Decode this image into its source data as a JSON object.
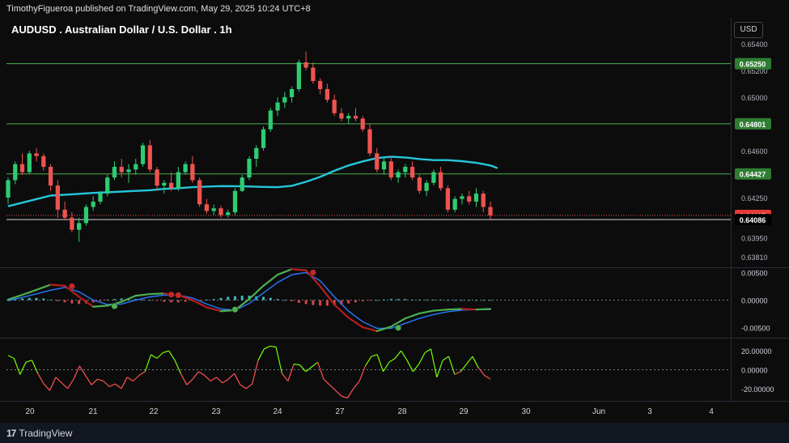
{
  "header": {
    "published_by": "TimothyFigueroa published on TradingView.com, May 29, 2025 10:24 UTC+8"
  },
  "title": "AUDUSD . Australian Dollar / U.S. Dollar . 1h",
  "currency": "USD",
  "footer": {
    "brand": "TradingView"
  },
  "colors": {
    "background": "#0c0c0c",
    "up": "#26a69a",
    "up_bright": "#2ecc71",
    "down": "#ef5350",
    "ma": "#26c6da",
    "level_line": "#4caf50",
    "tag_green": "#2e7d32",
    "tag_red": "#e53935",
    "tag_black": "#000000"
  },
  "chart_data": [
    {
      "type": "candlestick",
      "name": "price",
      "x_tick_labels": [
        "20",
        "21",
        "22",
        "23",
        "24",
        "27",
        "28",
        "29",
        "30",
        "Jun",
        "3",
        "4"
      ],
      "y_tick_labels": [
        "0.65400",
        "0.65200",
        "0.65000",
        "0.64600",
        "0.64250",
        "0.63950",
        "0.63810"
      ],
      "ylim": [
        0.6373,
        0.6558
      ],
      "levels": [
        {
          "value": 0.6525,
          "label": "0.65250",
          "style": "green-line"
        },
        {
          "value": 0.64801,
          "label": "0.64801",
          "style": "green-line"
        },
        {
          "value": 0.64427,
          "label": "0.64427",
          "style": "green-line"
        },
        {
          "value": 0.64117,
          "label": "0.64117",
          "style": "red-dotted-current-price"
        },
        {
          "value": 0.64086,
          "label": "0.64086",
          "style": "black-line"
        }
      ],
      "moving_average_path": [
        [
          0,
          0.64185
        ],
        [
          3,
          0.64225
        ],
        [
          6,
          0.64265
        ],
        [
          9,
          0.64275
        ],
        [
          12,
          0.64285
        ],
        [
          15,
          0.64292
        ],
        [
          18,
          0.643
        ],
        [
          20,
          0.64305
        ],
        [
          22,
          0.64315
        ],
        [
          24,
          0.6432
        ],
        [
          26,
          0.64328
        ],
        [
          28,
          0.64332
        ],
        [
          30,
          0.64336
        ],
        [
          33,
          0.64335
        ],
        [
          36,
          0.6433
        ],
        [
          38,
          0.64328
        ],
        [
          40,
          0.64338
        ],
        [
          42,
          0.64368
        ],
        [
          44,
          0.64405
        ],
        [
          46,
          0.6445
        ],
        [
          48,
          0.6449
        ],
        [
          50,
          0.6452
        ],
        [
          52,
          0.64545
        ],
        [
          54,
          0.64555
        ],
        [
          56,
          0.6455
        ],
        [
          58,
          0.64538
        ],
        [
          60,
          0.6453
        ],
        [
          62,
          0.6453
        ],
        [
          64,
          0.64522
        ],
        [
          66,
          0.6451
        ],
        [
          68,
          0.6449
        ],
        [
          69,
          0.6447
        ]
      ],
      "candles": [
        [
          0.6425,
          0.644,
          0.642,
          0.6438
        ],
        [
          0.6438,
          0.6452,
          0.6435,
          0.645
        ],
        [
          0.645,
          0.6458,
          0.6442,
          0.6444
        ],
        [
          0.6444,
          0.646,
          0.6443,
          0.6458
        ],
        [
          0.6458,
          0.6462,
          0.6452,
          0.6456
        ],
        [
          0.6456,
          0.6458,
          0.6445,
          0.6448
        ],
        [
          0.6448,
          0.645,
          0.643,
          0.6434
        ],
        [
          0.6434,
          0.6438,
          0.641,
          0.6416
        ],
        [
          0.6416,
          0.6422,
          0.6408,
          0.641
        ],
        [
          0.641,
          0.6414,
          0.6399,
          0.6401
        ],
        [
          0.6401,
          0.641,
          0.6392,
          0.6406
        ],
        [
          0.6406,
          0.642,
          0.6404,
          0.6418
        ],
        [
          0.6418,
          0.6426,
          0.6415,
          0.6422
        ],
        [
          0.6422,
          0.643,
          0.642,
          0.6428
        ],
        [
          0.6428,
          0.6442,
          0.6426,
          0.644
        ],
        [
          0.644,
          0.6452,
          0.6438,
          0.6448
        ],
        [
          0.6448,
          0.6454,
          0.644,
          0.6444
        ],
        [
          0.6444,
          0.645,
          0.6436,
          0.6446
        ],
        [
          0.6446,
          0.6454,
          0.6442,
          0.645
        ],
        [
          0.645,
          0.6466,
          0.6448,
          0.6464
        ],
        [
          0.6464,
          0.6468,
          0.6444,
          0.6446
        ],
        [
          0.6446,
          0.6448,
          0.643,
          0.6434
        ],
        [
          0.6434,
          0.6438,
          0.6428,
          0.6436
        ],
        [
          0.6436,
          0.6444,
          0.643,
          0.6432
        ],
        [
          0.6432,
          0.6448,
          0.643,
          0.6444
        ],
        [
          0.6444,
          0.6452,
          0.6442,
          0.645
        ],
        [
          0.645,
          0.6456,
          0.6436,
          0.6438
        ],
        [
          0.6438,
          0.644,
          0.6418,
          0.642
        ],
        [
          0.642,
          0.6424,
          0.6413,
          0.6415
        ],
        [
          0.6415,
          0.642,
          0.6412,
          0.6417
        ],
        [
          0.6417,
          0.6419,
          0.641,
          0.6412
        ],
        [
          0.6412,
          0.6416,
          0.641,
          0.6414
        ],
        [
          0.6414,
          0.6432,
          0.6412,
          0.643
        ],
        [
          0.643,
          0.6442,
          0.6429,
          0.644
        ],
        [
          0.644,
          0.6456,
          0.6438,
          0.6454
        ],
        [
          0.6454,
          0.6464,
          0.6448,
          0.6462
        ],
        [
          0.6462,
          0.6478,
          0.646,
          0.6476
        ],
        [
          0.6476,
          0.6492,
          0.6474,
          0.649
        ],
        [
          0.649,
          0.65,
          0.6486,
          0.6496
        ],
        [
          0.6496,
          0.6504,
          0.6492,
          0.65
        ],
        [
          0.65,
          0.6508,
          0.6496,
          0.6506
        ],
        [
          0.6506,
          0.6528,
          0.6504,
          0.6526
        ],
        [
          0.6526,
          0.6534,
          0.652,
          0.6522
        ],
        [
          0.6522,
          0.6526,
          0.651,
          0.6512
        ],
        [
          0.6512,
          0.6514,
          0.6502,
          0.6506
        ],
        [
          0.6506,
          0.651,
          0.6496,
          0.6498
        ],
        [
          0.6498,
          0.6502,
          0.6486,
          0.6488
        ],
        [
          0.6488,
          0.6492,
          0.6482,
          0.6484
        ],
        [
          0.6484,
          0.6488,
          0.648,
          0.6486
        ],
        [
          0.6486,
          0.6492,
          0.6482,
          0.6484
        ],
        [
          0.6484,
          0.6486,
          0.6474,
          0.6476
        ],
        [
          0.6476,
          0.648,
          0.6456,
          0.6458
        ],
        [
          0.6458,
          0.6462,
          0.6444,
          0.6446
        ],
        [
          0.6446,
          0.6454,
          0.6442,
          0.6452
        ],
        [
          0.6452,
          0.6456,
          0.6438,
          0.644
        ],
        [
          0.644,
          0.6446,
          0.6436,
          0.6444
        ],
        [
          0.6444,
          0.645,
          0.644,
          0.6448
        ],
        [
          0.6448,
          0.6452,
          0.6438,
          0.644
        ],
        [
          0.644,
          0.6442,
          0.6428,
          0.643
        ],
        [
          0.643,
          0.6438,
          0.6426,
          0.6436
        ],
        [
          0.6436,
          0.6446,
          0.6434,
          0.6444
        ],
        [
          0.6444,
          0.6448,
          0.643,
          0.6432
        ],
        [
          0.6432,
          0.6434,
          0.6414,
          0.6416
        ],
        [
          0.6416,
          0.6426,
          0.6414,
          0.6424
        ],
        [
          0.6424,
          0.6428,
          0.642,
          0.6426
        ],
        [
          0.6426,
          0.643,
          0.642,
          0.6422
        ],
        [
          0.6422,
          0.6432,
          0.6418,
          0.6428
        ],
        [
          0.6428,
          0.643,
          0.6414,
          0.6418
        ],
        [
          0.6418,
          0.6422,
          0.6408,
          0.64117
        ]
      ]
    },
    {
      "type": "oscillator",
      "name": "macd",
      "y_tick_labels": [
        "0.00500",
        "0.00000",
        "-0.00500"
      ],
      "ylim": [
        -0.0068,
        0.0058
      ],
      "line_green": [
        [
          0,
          0.0001
        ],
        [
          3,
          0.0014
        ],
        [
          6,
          0.0028
        ],
        [
          8,
          0.0026
        ],
        [
          10,
          0.0006
        ],
        [
          12,
          -0.0012
        ],
        [
          14,
          -0.001
        ],
        [
          16,
          -0.0003
        ],
        [
          18,
          0.0008
        ],
        [
          20,
          0.0011
        ],
        [
          22,
          0.0012
        ],
        [
          24,
          0.0009
        ],
        [
          26,
          0.0
        ],
        [
          28,
          -0.0013
        ],
        [
          30,
          -0.002
        ],
        [
          32,
          -0.0018
        ],
        [
          34,
          0.0002
        ],
        [
          36,
          0.0026
        ],
        [
          38,
          0.0046
        ],
        [
          40,
          0.0056
        ],
        [
          42,
          0.0054
        ],
        [
          44,
          0.0025
        ],
        [
          46,
          -0.0008
        ],
        [
          48,
          -0.0032
        ],
        [
          50,
          -0.0049
        ],
        [
          52,
          -0.0056
        ],
        [
          54,
          -0.0048
        ],
        [
          56,
          -0.0033
        ],
        [
          58,
          -0.0024
        ],
        [
          60,
          -0.0019
        ],
        [
          62,
          -0.0017
        ],
        [
          64,
          -0.0016
        ],
        [
          66,
          -0.0017
        ],
        [
          68,
          -0.0016
        ]
      ],
      "line_blue": [
        [
          0,
          -0.0001
        ],
        [
          3,
          0.0008
        ],
        [
          6,
          0.0018
        ],
        [
          8,
          0.0023
        ],
        [
          10,
          0.0015
        ],
        [
          12,
          0.0
        ],
        [
          14,
          -0.0008
        ],
        [
          16,
          -0.0007
        ],
        [
          18,
          0.0
        ],
        [
          20,
          0.0006
        ],
        [
          22,
          0.0009
        ],
        [
          24,
          0.0009
        ],
        [
          26,
          0.0004
        ],
        [
          28,
          -0.0007
        ],
        [
          30,
          -0.0016
        ],
        [
          32,
          -0.0018
        ],
        [
          34,
          -0.0006
        ],
        [
          36,
          0.0013
        ],
        [
          38,
          0.0032
        ],
        [
          40,
          0.0046
        ],
        [
          42,
          0.005
        ],
        [
          44,
          0.0035
        ],
        [
          46,
          0.0006
        ],
        [
          48,
          -0.002
        ],
        [
          50,
          -0.0039
        ],
        [
          52,
          -0.0051
        ],
        [
          54,
          -0.0051
        ],
        [
          56,
          -0.0042
        ],
        [
          58,
          -0.0033
        ],
        [
          60,
          -0.0026
        ],
        [
          62,
          -0.0021
        ],
        [
          64,
          -0.0018
        ],
        [
          66,
          -0.0017
        ],
        [
          68,
          -0.0017
        ]
      ],
      "cross_points": [
        [
          9,
          0.0025,
          "down"
        ],
        [
          15,
          -0.0011,
          "up"
        ],
        [
          23,
          0.001,
          "down"
        ],
        [
          24,
          0.0009,
          "down"
        ],
        [
          32,
          -0.0017,
          "up"
        ],
        [
          43,
          0.005,
          "down"
        ],
        [
          55,
          -0.005,
          "up"
        ]
      ],
      "histogram": [
        0.0001,
        0.0002,
        0.0003,
        0.0004,
        0.0004,
        0.0003,
        0.0001,
        -0.0002,
        -0.0004,
        -0.0006,
        -0.0007,
        -0.0006,
        -0.0004,
        -0.0002,
        0.0001,
        0.0002,
        0.0003,
        0.0003,
        0.0002,
        0.0001,
        0.0,
        -0.0001,
        -0.0003,
        -0.0004,
        -0.0004,
        -0.0003,
        -0.0002,
        -0.0001,
        0.0001,
        0.0002,
        0.0004,
        0.0006,
        0.0007,
        0.0008,
        0.0008,
        0.0007,
        0.0006,
        0.0004,
        0.0002,
        0.0,
        -0.0002,
        -0.0005,
        -0.0007,
        -0.0009,
        -0.001,
        -0.001,
        -0.0009,
        -0.0008,
        -0.0006,
        -0.0004,
        -0.0002,
        -0.0001,
        0.0,
        0.0001,
        0.0002,
        0.0002,
        0.0002,
        0.0001,
        0.0001,
        0.0001,
        0.0001,
        0.0001,
        0.0,
        0.0,
        0.0,
        0.0,
        0.0,
        0.0,
        0.0
      ]
    },
    {
      "type": "oscillator",
      "name": "momentum",
      "y_tick_labels": [
        "20.00000",
        "0.00000",
        "-20.00000"
      ],
      "ylim": [
        -33,
        33
      ],
      "values": [
        15,
        12,
        -5,
        8,
        10,
        -4,
        -15,
        -22,
        -8,
        -14,
        -20,
        -10,
        4,
        -6,
        -16,
        -10,
        -12,
        -18,
        -15,
        -20,
        -8,
        -12,
        -6,
        -2,
        16,
        12,
        18,
        20,
        10,
        -4,
        -16,
        -10,
        -2,
        -6,
        -12,
        -8,
        -14,
        -10,
        -4,
        -16,
        -20,
        -15,
        10,
        22,
        25,
        24,
        -4,
        -12,
        6,
        5,
        -2,
        3,
        8,
        -10,
        -16,
        -22,
        -28,
        -30,
        -20,
        -12,
        4,
        14,
        16,
        -2,
        8,
        12,
        20,
        10,
        -2,
        6,
        18,
        22,
        -8,
        10,
        14,
        -5,
        -2,
        6,
        14,
        2,
        -6,
        -10
      ]
    }
  ]
}
